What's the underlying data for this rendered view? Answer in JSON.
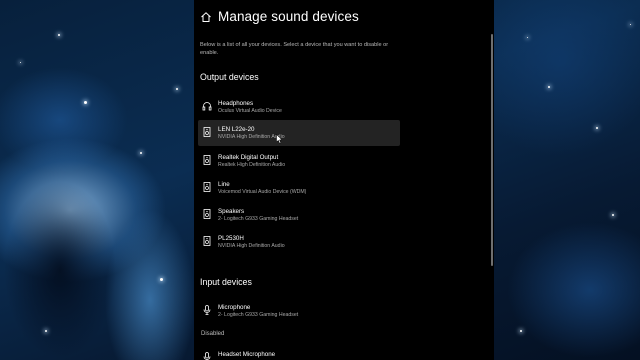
{
  "page": {
    "title": "Manage sound devices",
    "description": "Below is a list of all your devices. Select a device that you want to disable or enable."
  },
  "output_section": {
    "heading": "Output devices",
    "devices": [
      {
        "name": "Headphones",
        "driver": "Oculus Virtual Audio Device",
        "icon": "headphones-icon"
      },
      {
        "name": "LEN L22e-20",
        "driver": "NVIDIA High Definition Audio",
        "icon": "speaker-icon"
      },
      {
        "name": "Realtek Digital Output",
        "driver": "Realtek High Definition Audio",
        "icon": "speaker-icon"
      },
      {
        "name": "Line",
        "driver": "Voicemod Virtual Audio Device (WDM)",
        "icon": "speaker-icon"
      },
      {
        "name": "Speakers",
        "driver": "2- Logitech G933 Gaming Headset",
        "icon": "speaker-icon"
      },
      {
        "name": "PL2530H",
        "driver": "NVIDIA High Definition Audio",
        "icon": "speaker-icon"
      }
    ]
  },
  "input_section": {
    "heading": "Input devices",
    "devices": [
      {
        "name": "Microphone",
        "driver": "2- Logitech G933 Gaming Headset",
        "icon": "microphone-icon"
      }
    ],
    "disabled_label": "Disabled",
    "disabled_devices": [
      {
        "name": "Headset Microphone",
        "driver": "",
        "icon": "microphone-icon"
      }
    ]
  },
  "colors": {
    "panel_background": "#000000",
    "hover_background": "#232323",
    "secondary_text": "#a8a8a8"
  }
}
